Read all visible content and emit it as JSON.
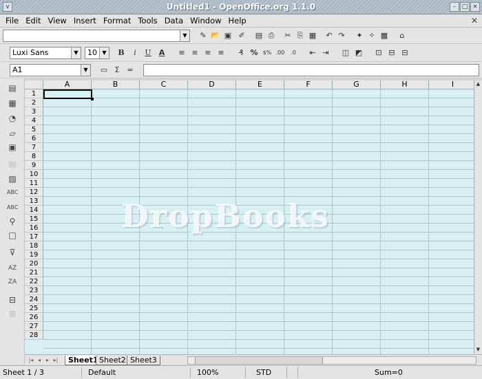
{
  "window": {
    "title": "Untitled1 - OpenOffice.org 1.1.0"
  },
  "menu": [
    "File",
    "Edit",
    "View",
    "Insert",
    "Format",
    "Tools",
    "Data",
    "Window",
    "Help"
  ],
  "toolbar": {
    "url_value": ""
  },
  "formatting": {
    "font_name": "Luxi Sans",
    "font_size": "10",
    "bold": "B",
    "italic": "i",
    "underline": "U",
    "font_color": "A"
  },
  "formula": {
    "name_box": "A1",
    "sigma": "Σ",
    "equals": "=",
    "content": ""
  },
  "columns": [
    "A",
    "B",
    "C",
    "D",
    "E",
    "F",
    "G",
    "H",
    "I"
  ],
  "rows": [
    "1",
    "2",
    "3",
    "4",
    "5",
    "6",
    "7",
    "8",
    "9",
    "10",
    "11",
    "12",
    "13",
    "14",
    "15",
    "16",
    "17",
    "18",
    "19",
    "20",
    "21",
    "22",
    "23",
    "24",
    "25",
    "26",
    "27",
    "28"
  ],
  "active_cell": "A1",
  "sheets": [
    "Sheet1",
    "Sheet2",
    "Sheet3"
  ],
  "active_sheet": "Sheet1",
  "watermark": "DropBooks",
  "status": {
    "sheet": "Sheet 1 / 3",
    "page_style": "Default",
    "zoom": "100%",
    "mode": "STD",
    "sum": "Sum=0"
  },
  "icons": {
    "standard": [
      "edit-file-icon",
      "open-icon",
      "save-icon",
      "edit-doc-icon",
      "export-pdf-icon",
      "print-icon",
      "cut-icon",
      "copy-icon",
      "paste-icon",
      "undo-icon",
      "redo-icon",
      "navigator-icon",
      "stylist-icon",
      "gallery-icon",
      "datasource-icon"
    ],
    "format": [
      "align-left-icon",
      "align-center-icon",
      "align-right-icon",
      "justify-icon",
      "currency-icon",
      "percent-icon",
      "standard-format-icon",
      "add-decimal-icon",
      "delete-decimal-icon",
      "decrease-indent-icon",
      "increase-indent-icon",
      "borders-icon",
      "background-color-icon",
      "merge-cells-icon",
      "align-top-icon",
      "align-center-v-icon",
      "align-bottom-icon"
    ],
    "left": [
      "insert-icon",
      "insert-cells-icon",
      "insert-object-icon",
      "show-draw-icon",
      "edit-mode-icon",
      "disabled-icon",
      "show-changes-icon",
      "spellcheck-icon",
      "autospell-icon",
      "find-icon",
      "datasource-view-icon",
      "autofilter-icon",
      "sort-ascending-icon",
      "sort-descending-icon",
      "insert-chart-icon",
      "disabled-grid-icon"
    ]
  }
}
